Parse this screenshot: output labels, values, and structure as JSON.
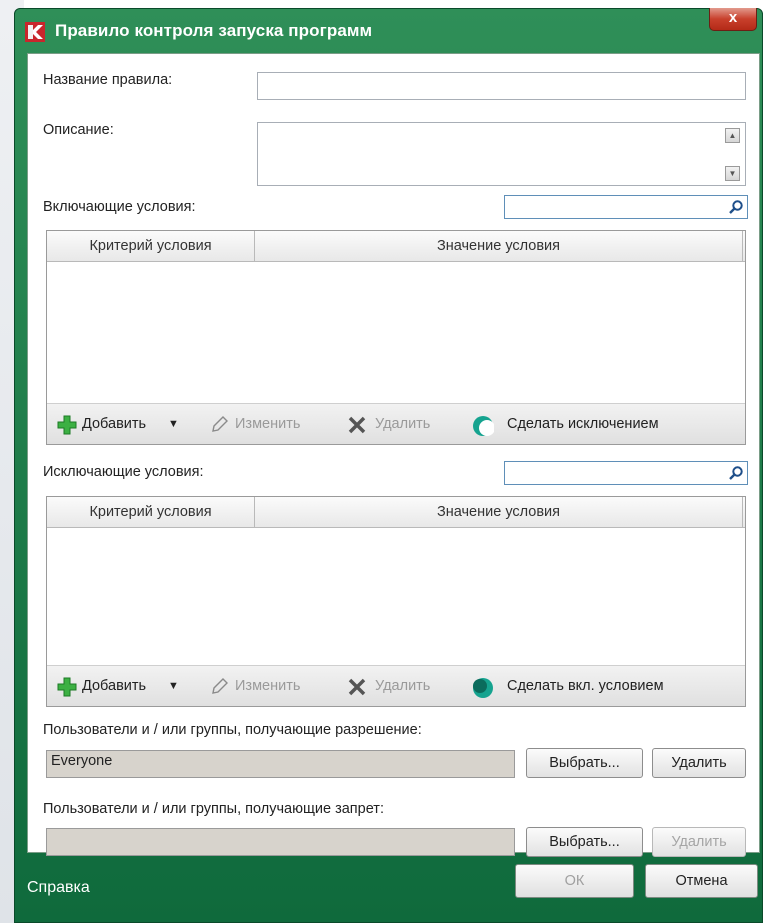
{
  "window": {
    "title": "Правило контроля запуска программ",
    "close_label": "x"
  },
  "form": {
    "rule_name_label": "Название правила:",
    "rule_name_value": "",
    "description_label": "Описание:",
    "description_value": "",
    "include_label": "Включающие условия:",
    "exclude_label": "Исключающие условия:",
    "allow_label": "Пользователи и / или группы, получающие разрешение:",
    "allow_value": "Everyone",
    "deny_label": "Пользователи и / или группы, получающие запрет:",
    "deny_value": ""
  },
  "include_grid": {
    "columns": [
      "Критерий условия",
      "Значение условия"
    ],
    "rows": [],
    "tools": {
      "add": "Добавить",
      "edit": "Изменить",
      "delete": "Удалить",
      "toggle": "Сделать исключением"
    }
  },
  "exclude_grid": {
    "columns": [
      "Критерий условия",
      "Значение условия"
    ],
    "rows": [],
    "tools": {
      "add": "Добавить",
      "edit": "Изменить",
      "delete": "Удалить",
      "toggle": "Сделать вкл. условием"
    }
  },
  "buttons": {
    "select": "Выбрать...",
    "remove": "Удалить",
    "ok": "ОК",
    "cancel": "Отмена",
    "help": "Справка"
  },
  "colors": {
    "title_green": "#1f7a48",
    "accent_teal": "#0a9a8a",
    "add_green": "#2aa83a"
  }
}
